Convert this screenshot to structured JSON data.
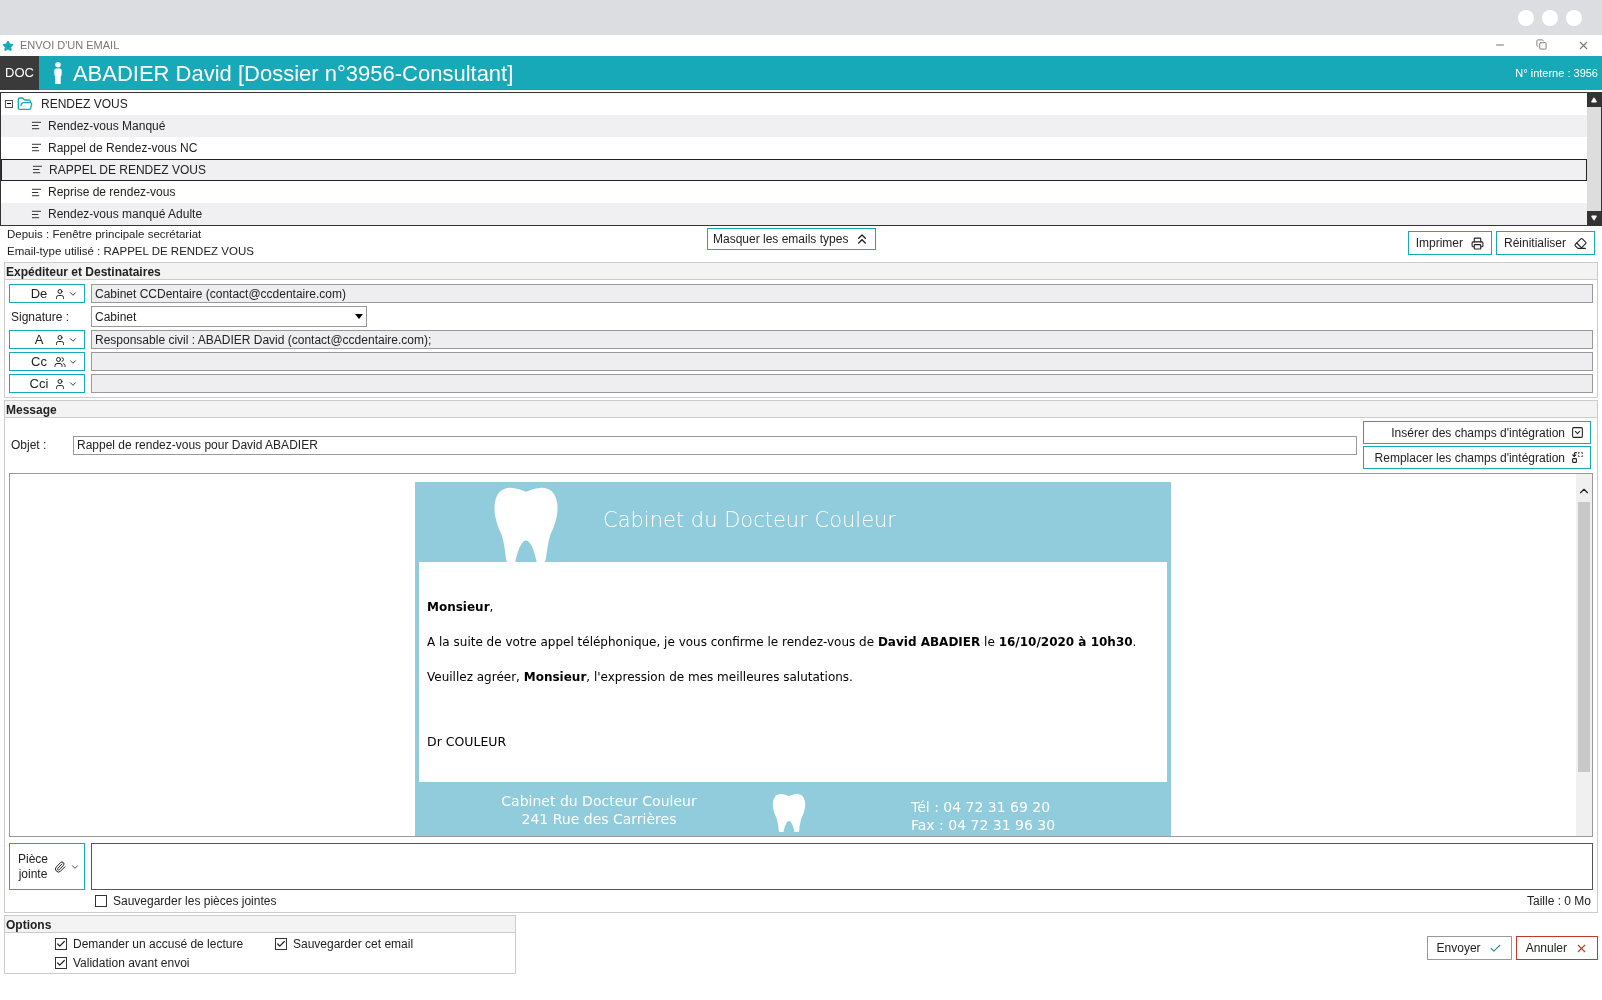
{
  "window": {
    "title": "ENVOI D'UN EMAIL"
  },
  "header": {
    "badge": "DOC",
    "patient": "ABADIER David [Dossier n°3956-Consultant]",
    "internal_label": "N° interne :",
    "internal_value": "3956"
  },
  "tree": {
    "label": "RENDEZ VOUS",
    "expanded": true,
    "children": [
      {
        "label": "Rendez-vous Manqué",
        "selected": false
      },
      {
        "label": "Rappel de  Rendez-vous NC",
        "selected": false
      },
      {
        "label": "RAPPEL DE RENDEZ VOUS",
        "selected": true
      },
      {
        "label": "Reprise de rendez-vous",
        "selected": false
      },
      {
        "label": "Rendez-vous manqué Adulte",
        "selected": false
      }
    ]
  },
  "info": {
    "from": "Depuis : Fenêtre principale secrétariat",
    "template": "Email-type utilisé : RAPPEL DE RENDEZ VOUS"
  },
  "toggle_templates": "Masquer les emails types",
  "actions": [
    "Imprimer",
    "Réinitialiser"
  ],
  "senders_section": {
    "title": "Expéditeur et Destinataires",
    "rows": [
      {
        "kind": "recipient",
        "label": "De",
        "value": "Cabinet CCDentaire (contact@ccdentaire.com)"
      },
      {
        "kind": "select",
        "label": "Signature :",
        "value": "Cabinet"
      },
      {
        "kind": "recipient",
        "label": "A",
        "value": "Responsable civil : ABADIER David (contact@ccdentaire.com);"
      },
      {
        "kind": "recipient",
        "label": "Cc",
        "value": ""
      },
      {
        "kind": "recipient",
        "label": "Cci",
        "value": ""
      }
    ]
  },
  "message": {
    "title": "Message",
    "subject_label": "Objet :",
    "subject": "Rappel de rendez-vous pour David ABADIER",
    "field_buttons": [
      "Insérer des champs d'intégration",
      "Remplacer les champs d'intégration"
    ],
    "letter": {
      "heading": "Cabinet du Docteur Couleur",
      "paragraphs": [
        "**Monsieur**,",
        "A la suite de votre appel téléphonique, je vous confirme le rendez-vous de **David ABADIER** le **16/10/2020 à 10h30**.",
        "Veuillez agréer, **Monsieur**, l'expression de mes meilleures salutations."
      ],
      "signature": "Dr COULEUR",
      "footer_left": [
        "Cabinet du Docteur Couleur",
        "241 Rue des Carrières"
      ],
      "footer_right": [
        "Tél : 04 72 31 69 20",
        "Fax : 04 72 31 96 30"
      ]
    }
  },
  "attachments": {
    "button": "Pièce jointe",
    "save_label": "Sauvegarder les pièces jointes",
    "save_checked": false,
    "size": "Taille : 0 Mo"
  },
  "options": {
    "title": "Options",
    "items": [
      {
        "label": "Demander un accusé de lecture",
        "checked": true
      },
      {
        "label": "Sauvegarder cet email",
        "checked": true
      },
      {
        "label": "Validation avant envoi",
        "checked": true
      }
    ]
  },
  "footer_buttons": [
    {
      "label": "Envoyer",
      "kind": "confirm"
    },
    {
      "label": "Annuler",
      "kind": "cancel"
    }
  ]
}
